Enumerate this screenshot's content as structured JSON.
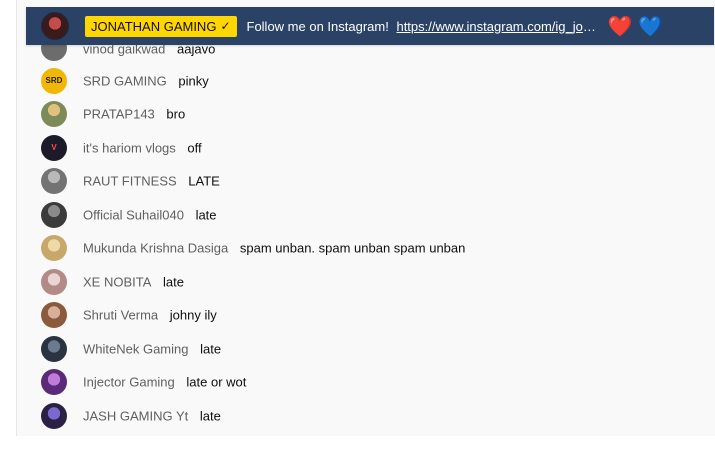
{
  "banner": {
    "author": "JONATHAN GAMING",
    "verified_icon": "check-icon",
    "message": "Follow me on Instagram!",
    "link": "https://www.instagram.com/ig_jonathan...",
    "emoji_1": "❤️",
    "emoji_2": "💙"
  },
  "messages": [
    {
      "author": "vinod gaikwad",
      "text": "aajavo",
      "avatar_color": "#6c6c6c"
    },
    {
      "author": "SRD GAMING",
      "text": "pinky",
      "avatar_color": "#f2b705"
    },
    {
      "author": "PRATAP143",
      "text": "bro",
      "avatar_color": "#7d8a5a"
    },
    {
      "author": "it's hariom vlogs",
      "text": "off",
      "avatar_color": "#1b1b2a"
    },
    {
      "author": "RAUT FITNESS",
      "text": "LATE",
      "avatar_color": "#737373"
    },
    {
      "author": "Official Suhail040",
      "text": "late",
      "avatar_color": "#3b3b3b"
    },
    {
      "author": "Mukunda Krishna Dasiga",
      "text": "spam unban. spam unban spam unban",
      "avatar_color": "#c8a86a"
    },
    {
      "author": "XE NOBITA",
      "text": "late",
      "avatar_color": "#b38a86"
    },
    {
      "author": "Shruti Verma",
      "text": "johny ily",
      "avatar_color": "#8b5a3c"
    },
    {
      "author": "WhiteNek Gaming",
      "text": "late",
      "avatar_color": "#2a3340"
    },
    {
      "author": "Injector Gaming",
      "text": "late or wot",
      "avatar_color": "#5a2a78"
    },
    {
      "author": "JASH GAMING Yt",
      "text": "late",
      "avatar_color": "#2b2145"
    }
  ]
}
